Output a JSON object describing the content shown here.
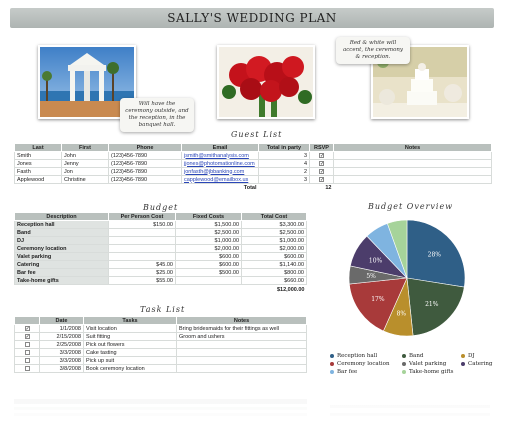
{
  "title": "SALLY'S WEDDING PLAN",
  "callouts": {
    "ceremony": "Will have the ceremony outside, and the reception, in the banquet hall.",
    "colors": "Red & white will accent, the ceremony & reception."
  },
  "photos": {
    "pavilion": "pavilion-photo",
    "roses": "roses-photo",
    "cake": "cake-photo"
  },
  "guest_list": {
    "title": "Guest List",
    "columns": [
      "Last",
      "First",
      "Phone",
      "Email",
      "Total in party",
      "RSVP",
      "Notes"
    ],
    "rows": [
      {
        "last": "Smith",
        "first": "John",
        "phone": "(123)456-7890",
        "email": "jsmith@smithanalysis.com",
        "total": "3",
        "rsvp": true,
        "notes": ""
      },
      {
        "last": "Jones",
        "first": "Jenny",
        "phone": "(123)456-7890",
        "email": "jjones@photomationline.com",
        "total": "4",
        "rsvp": true,
        "notes": ""
      },
      {
        "last": "Fasth",
        "first": "Jon",
        "phone": "(123)456-7890",
        "email": "jonfasth@jbbanking.com",
        "total": "2",
        "rsvp": true,
        "notes": ""
      },
      {
        "last": "Applewood",
        "first": "Christine",
        "phone": "(123)456-7890",
        "email": "capplewood@emailbox.us",
        "total": "3",
        "rsvp": true,
        "notes": ""
      }
    ],
    "total_label": "Total",
    "total_value": "12"
  },
  "budget": {
    "title": "Budget",
    "columns": [
      "Description",
      "Per Person Cost",
      "Fixed Costs",
      "Total Cost"
    ],
    "rows": [
      {
        "desc": "Reception hall",
        "per": "$150.00",
        "fixed": "$1,500.00",
        "total": "$3,300.00"
      },
      {
        "desc": "Band",
        "per": "",
        "fixed": "$2,500.00",
        "total": "$2,500.00"
      },
      {
        "desc": "DJ",
        "per": "",
        "fixed": "$1,000.00",
        "total": "$1,000.00"
      },
      {
        "desc": "Ceremony location",
        "per": "",
        "fixed": "$2,000.00",
        "total": "$2,000.00"
      },
      {
        "desc": "Valet parking",
        "per": "",
        "fixed": "$600.00",
        "total": "$600.00"
      },
      {
        "desc": "Catering",
        "per": "$45.00",
        "fixed": "$600.00",
        "total": "$1,140.00"
      },
      {
        "desc": "Bar fee",
        "per": "$25.00",
        "fixed": "$500.00",
        "total": "$800.00"
      },
      {
        "desc": "Take-home gifts",
        "per": "$55.00",
        "fixed": "",
        "total": "$660.00"
      }
    ],
    "grand_total": "$12,000.00"
  },
  "tasks": {
    "title": "Task List",
    "columns": [
      "",
      "Date",
      "Tasks",
      "Notes"
    ],
    "rows": [
      {
        "done": true,
        "date": "1/1/2008",
        "task": "Visit location",
        "notes": "Bring bridesmaids for their fittings as well"
      },
      {
        "done": true,
        "date": "2/15/2008",
        "task": "Suit fitting",
        "notes": "Groom and ushers"
      },
      {
        "done": false,
        "date": "2/25/2008",
        "task": "Pick out flowers",
        "notes": ""
      },
      {
        "done": false,
        "date": "3/3/2008",
        "task": "Cake tasting",
        "notes": ""
      },
      {
        "done": false,
        "date": "3/3/2008",
        "task": "Pick up suit",
        "notes": ""
      },
      {
        "done": false,
        "date": "3/8/2008",
        "task": "Book ceremony location",
        "notes": ""
      }
    ]
  },
  "budget_overview": {
    "title": "Budget Overview"
  },
  "chart_data": {
    "type": "pie",
    "title": "Budget Overview",
    "categories": [
      "Reception hall",
      "Band",
      "DJ",
      "Ceremony location",
      "Valet parking",
      "Catering",
      "Bar fee",
      "Take-home gifts"
    ],
    "values": [
      3300,
      2500,
      1000,
      2000,
      600,
      1140,
      800,
      660
    ],
    "percent_labels": [
      "28%",
      "21%",
      "8%",
      "17%",
      "5%",
      "10%",
      "",
      ""
    ],
    "colors": [
      "#2f5f87",
      "#3f5a3e",
      "#b98f2c",
      "#a83a3a",
      "#6a6a6a",
      "#4c3d6b",
      "#7fb4e0",
      "#a6d39a"
    ],
    "legend_position": "bottom"
  }
}
